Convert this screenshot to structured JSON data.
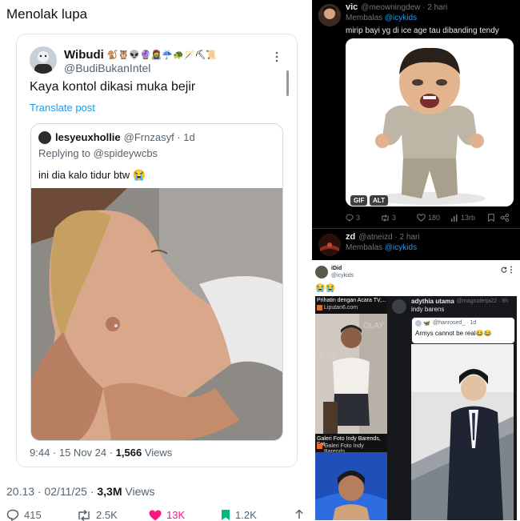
{
  "caption": "Menolak lupa",
  "left_tweet": {
    "author_name": "Wibudi",
    "author_emojis": "🐒🦉👽🔮🧟‍♀️☔🐢🪄⛏📜",
    "author_handle": "@BudiBukanIntel",
    "text": "Kaya kontol dikasi muka bejir",
    "translate": "Translate post",
    "quote": {
      "author": "lesyeuxhollie",
      "handle_time": "@Frnzasyf · 1d",
      "replying_label": "Replying to ",
      "replying_handle": "@spideywcbs",
      "text": "ini dia kalo tidur btw 😭"
    },
    "inner_time": "9:44 · 15 Nov 24 · ",
    "inner_views_count": "1,566",
    "inner_views_label": " Views",
    "post_time": "20.13 · 02/11/25 · ",
    "post_views_count": "3,3M",
    "post_views_label": " Views",
    "stats": {
      "replies": "415",
      "reposts": "2.5K",
      "likes": "13K",
      "bookmarks": "1.2K"
    }
  },
  "right_top": {
    "reply1": {
      "name": "vic",
      "handle_time": "@meowningdew · 2 hari",
      "replying_label": "Membalas ",
      "replying_handle": "@icykids",
      "text": "mirip bayi yg di ice age tau dibanding tendy",
      "badge_gif": "GIF",
      "badge_alt": "ALT",
      "stats": {
        "replies": "3",
        "reposts": "3",
        "likes": "180",
        "views": "13rb"
      }
    },
    "reply2": {
      "name": "zd",
      "handle_time": "@atneizd · 2 hari",
      "replying_label": "Membalas ",
      "replying_handle": "@icykids"
    }
  },
  "right_bottom": {
    "name": "iDid",
    "handle": "@icykids",
    "text": "😭😭",
    "news_title": "Prihatin dengan Acara TV,...",
    "news_source": "Liputan6.com",
    "gallery_title": "Galeri Foto Indy Barends, Fot...",
    "gallery_source": "Galeri Foto Indy Barends,...",
    "post_name": "adythia utama",
    "post_handle": "@magruderja22 · 8h",
    "post_text": "indy barens",
    "quote_handle": "@hanrosed_ · 1d",
    "quote_text": "Armys cannot be real😂😂"
  }
}
